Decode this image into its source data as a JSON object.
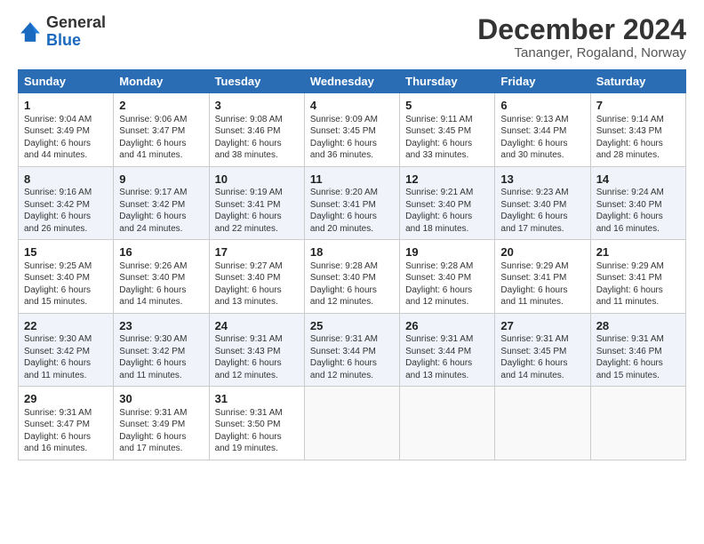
{
  "logo": {
    "general": "General",
    "blue": "Blue"
  },
  "title": "December 2024",
  "subtitle": "Tananger, Rogaland, Norway",
  "headers": [
    "Sunday",
    "Monday",
    "Tuesday",
    "Wednesday",
    "Thursday",
    "Friday",
    "Saturday"
  ],
  "weeks": [
    [
      {
        "day": "1",
        "lines": [
          "Sunrise: 9:04 AM",
          "Sunset: 3:49 PM",
          "Daylight: 6 hours",
          "and 44 minutes."
        ]
      },
      {
        "day": "2",
        "lines": [
          "Sunrise: 9:06 AM",
          "Sunset: 3:47 PM",
          "Daylight: 6 hours",
          "and 41 minutes."
        ]
      },
      {
        "day": "3",
        "lines": [
          "Sunrise: 9:08 AM",
          "Sunset: 3:46 PM",
          "Daylight: 6 hours",
          "and 38 minutes."
        ]
      },
      {
        "day": "4",
        "lines": [
          "Sunrise: 9:09 AM",
          "Sunset: 3:45 PM",
          "Daylight: 6 hours",
          "and 36 minutes."
        ]
      },
      {
        "day": "5",
        "lines": [
          "Sunrise: 9:11 AM",
          "Sunset: 3:45 PM",
          "Daylight: 6 hours",
          "and 33 minutes."
        ]
      },
      {
        "day": "6",
        "lines": [
          "Sunrise: 9:13 AM",
          "Sunset: 3:44 PM",
          "Daylight: 6 hours",
          "and 30 minutes."
        ]
      },
      {
        "day": "7",
        "lines": [
          "Sunrise: 9:14 AM",
          "Sunset: 3:43 PM",
          "Daylight: 6 hours",
          "and 28 minutes."
        ]
      }
    ],
    [
      {
        "day": "8",
        "lines": [
          "Sunrise: 9:16 AM",
          "Sunset: 3:42 PM",
          "Daylight: 6 hours",
          "and 26 minutes."
        ]
      },
      {
        "day": "9",
        "lines": [
          "Sunrise: 9:17 AM",
          "Sunset: 3:42 PM",
          "Daylight: 6 hours",
          "and 24 minutes."
        ]
      },
      {
        "day": "10",
        "lines": [
          "Sunrise: 9:19 AM",
          "Sunset: 3:41 PM",
          "Daylight: 6 hours",
          "and 22 minutes."
        ]
      },
      {
        "day": "11",
        "lines": [
          "Sunrise: 9:20 AM",
          "Sunset: 3:41 PM",
          "Daylight: 6 hours",
          "and 20 minutes."
        ]
      },
      {
        "day": "12",
        "lines": [
          "Sunrise: 9:21 AM",
          "Sunset: 3:40 PM",
          "Daylight: 6 hours",
          "and 18 minutes."
        ]
      },
      {
        "day": "13",
        "lines": [
          "Sunrise: 9:23 AM",
          "Sunset: 3:40 PM",
          "Daylight: 6 hours",
          "and 17 minutes."
        ]
      },
      {
        "day": "14",
        "lines": [
          "Sunrise: 9:24 AM",
          "Sunset: 3:40 PM",
          "Daylight: 6 hours",
          "and 16 minutes."
        ]
      }
    ],
    [
      {
        "day": "15",
        "lines": [
          "Sunrise: 9:25 AM",
          "Sunset: 3:40 PM",
          "Daylight: 6 hours",
          "and 15 minutes."
        ]
      },
      {
        "day": "16",
        "lines": [
          "Sunrise: 9:26 AM",
          "Sunset: 3:40 PM",
          "Daylight: 6 hours",
          "and 14 minutes."
        ]
      },
      {
        "day": "17",
        "lines": [
          "Sunrise: 9:27 AM",
          "Sunset: 3:40 PM",
          "Daylight: 6 hours",
          "and 13 minutes."
        ]
      },
      {
        "day": "18",
        "lines": [
          "Sunrise: 9:28 AM",
          "Sunset: 3:40 PM",
          "Daylight: 6 hours",
          "and 12 minutes."
        ]
      },
      {
        "day": "19",
        "lines": [
          "Sunrise: 9:28 AM",
          "Sunset: 3:40 PM",
          "Daylight: 6 hours",
          "and 12 minutes."
        ]
      },
      {
        "day": "20",
        "lines": [
          "Sunrise: 9:29 AM",
          "Sunset: 3:41 PM",
          "Daylight: 6 hours",
          "and 11 minutes."
        ]
      },
      {
        "day": "21",
        "lines": [
          "Sunrise: 9:29 AM",
          "Sunset: 3:41 PM",
          "Daylight: 6 hours",
          "and 11 minutes."
        ]
      }
    ],
    [
      {
        "day": "22",
        "lines": [
          "Sunrise: 9:30 AM",
          "Sunset: 3:42 PM",
          "Daylight: 6 hours",
          "and 11 minutes."
        ]
      },
      {
        "day": "23",
        "lines": [
          "Sunrise: 9:30 AM",
          "Sunset: 3:42 PM",
          "Daylight: 6 hours",
          "and 11 minutes."
        ]
      },
      {
        "day": "24",
        "lines": [
          "Sunrise: 9:31 AM",
          "Sunset: 3:43 PM",
          "Daylight: 6 hours",
          "and 12 minutes."
        ]
      },
      {
        "day": "25",
        "lines": [
          "Sunrise: 9:31 AM",
          "Sunset: 3:44 PM",
          "Daylight: 6 hours",
          "and 12 minutes."
        ]
      },
      {
        "day": "26",
        "lines": [
          "Sunrise: 9:31 AM",
          "Sunset: 3:44 PM",
          "Daylight: 6 hours",
          "and 13 minutes."
        ]
      },
      {
        "day": "27",
        "lines": [
          "Sunrise: 9:31 AM",
          "Sunset: 3:45 PM",
          "Daylight: 6 hours",
          "and 14 minutes."
        ]
      },
      {
        "day": "28",
        "lines": [
          "Sunrise: 9:31 AM",
          "Sunset: 3:46 PM",
          "Daylight: 6 hours",
          "and 15 minutes."
        ]
      }
    ],
    [
      {
        "day": "29",
        "lines": [
          "Sunrise: 9:31 AM",
          "Sunset: 3:47 PM",
          "Daylight: 6 hours",
          "and 16 minutes."
        ]
      },
      {
        "day": "30",
        "lines": [
          "Sunrise: 9:31 AM",
          "Sunset: 3:49 PM",
          "Daylight: 6 hours",
          "and 17 minutes."
        ]
      },
      {
        "day": "31",
        "lines": [
          "Sunrise: 9:31 AM",
          "Sunset: 3:50 PM",
          "Daylight: 6 hours",
          "and 19 minutes."
        ]
      },
      {
        "day": "",
        "lines": []
      },
      {
        "day": "",
        "lines": []
      },
      {
        "day": "",
        "lines": []
      },
      {
        "day": "",
        "lines": []
      }
    ]
  ]
}
